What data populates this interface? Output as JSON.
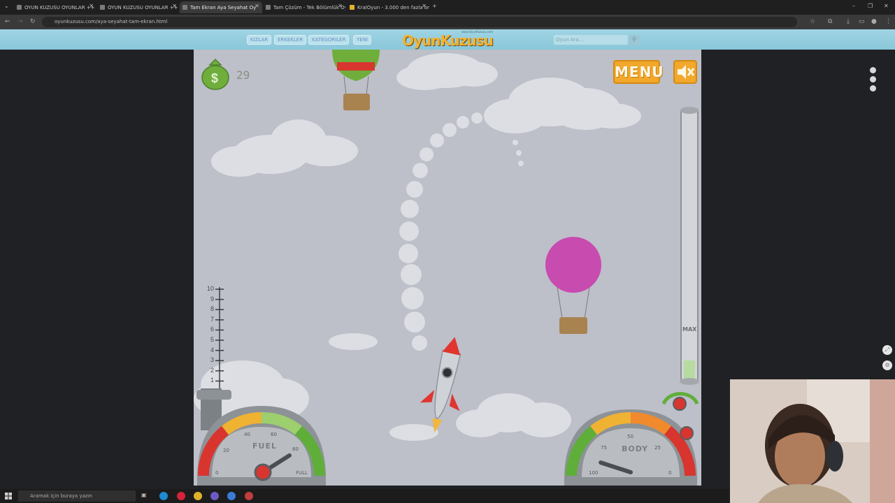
{
  "browser": {
    "tabs": [
      {
        "title": "OYUN KUZUSU OYUNLAR ++",
        "active": false
      },
      {
        "title": "OYUN KUZUSU OYUNLAR ++",
        "active": false
      },
      {
        "title": "Tam Ekran Aya Seyahat Oy",
        "active": true
      },
      {
        "title": "Tam Çözüm - Tek Bölümlük Oy",
        "active": false
      },
      {
        "title": "KralOyun - 3.000 den fazla onlin",
        "active": false
      }
    ],
    "url": "oyunkuzusu.com/aya-seyahat-tam-ekran.html"
  },
  "site": {
    "nav": [
      "KIZLAR",
      "ERKEKLER",
      "KATEGORİLER",
      "YENİ"
    ],
    "logo": "OyunKuzusu",
    "logo_small": "www.OyunKuzusu.com",
    "search_placeholder": "Oyun Ara..."
  },
  "game": {
    "money": "29",
    "menu_label": "MENU",
    "altitude_marks": [
      "10",
      "9",
      "8",
      "7",
      "6",
      "5",
      "4",
      "3",
      "2",
      "1"
    ],
    "max_label": "MAX",
    "fuel_gauge": {
      "label": "FUEL",
      "ticks": [
        "0",
        "20",
        "40",
        "60",
        "80",
        "FULL"
      ],
      "level_fraction": 0.82
    },
    "body_gauge": {
      "label": "BODY",
      "ticks": [
        "100",
        "75",
        "50",
        "25",
        "0"
      ],
      "level_fraction": 0.1
    },
    "colors": {
      "sky": "#bdbfc9",
      "menu_button": "#f1a82c",
      "balloon_pink": "#c84bb0",
      "balloon_green": "#6fae3b",
      "rocket_tip": "#e0362f"
    }
  },
  "taskbar": {
    "search_placeholder": "Aramak için buraya yazın"
  }
}
